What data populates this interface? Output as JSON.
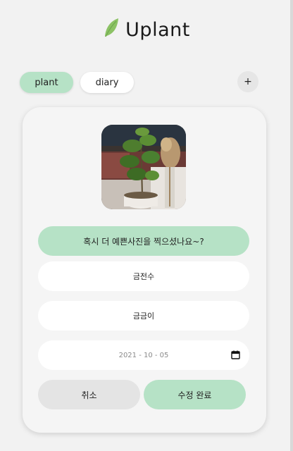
{
  "header": {
    "title": "Uplant",
    "logo_icon": "leaf-icon"
  },
  "tabs": [
    {
      "label": "plant",
      "active": true
    },
    {
      "label": "diary",
      "active": false
    }
  ],
  "add_button": {
    "label": "+"
  },
  "form": {
    "photo_prompt": "혹시 더 예쁜사진을 찍으셨나요~?",
    "plant_name": "금전수",
    "plant_nickname": "금금이",
    "date": "2021 - 10 - 05",
    "date_icon": "calendar-icon",
    "cancel_label": "취소",
    "submit_label": "수정 완료"
  },
  "colors": {
    "accent": "#b6e2c6",
    "background": "#f2f2f2",
    "card": "#f5f5f5",
    "muted": "#e4e4e4"
  }
}
